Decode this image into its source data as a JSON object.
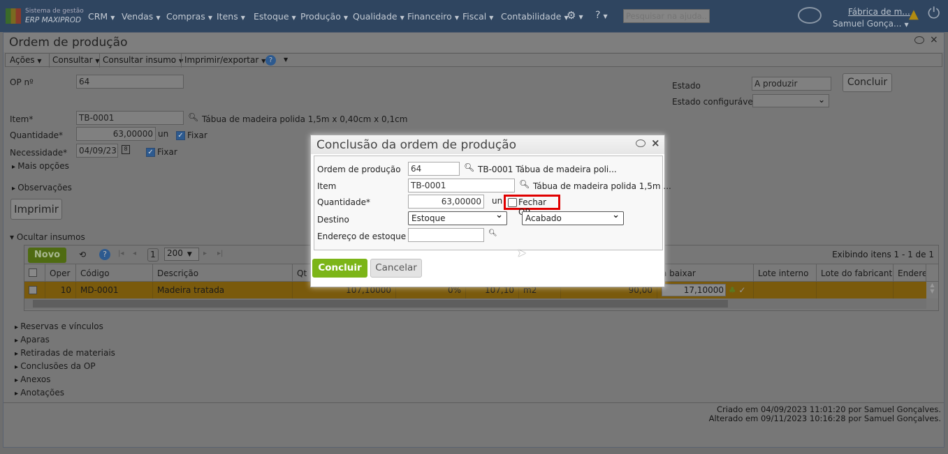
{
  "nav": {
    "logo_line1": "Sistema de gestão",
    "logo_line2": "ERP MAXIPROD",
    "menus": [
      "CRM",
      "Vendas",
      "Compras",
      "Itens",
      "Estoque",
      "Produção",
      "Qualidade",
      "Financeiro",
      "Fiscal",
      "Contabilidade"
    ],
    "search_placeholder": "Pesquisar na ajuda...",
    "company": "Fábrica de m...",
    "user": "Samuel Gonça..."
  },
  "window": {
    "title": "Ordem de produção",
    "toolbar": [
      "Ações",
      "Consultar",
      "Consultar insumo",
      "Imprimir/exportar"
    ]
  },
  "form": {
    "op_label": "OP nº",
    "op_value": "64",
    "item_label": "Item*",
    "item_value": "TB-0001",
    "item_desc": "Tábua de madeira polida 1,5m x 0,40cm x 0,1cm",
    "qty_label": "Quantidade*",
    "qty_value": "63,00000",
    "qty_unit": "un",
    "fixar": "Fixar",
    "need_label": "Necessidade*",
    "need_value": "04/09/23",
    "mais_opcoes": "Mais opções",
    "observacoes": "Observações",
    "imprimir": "Imprimir",
    "estado_label": "Estado",
    "estado_value": "A produzir",
    "estado_conf_label": "Estado configurável",
    "concluir": "Concluir"
  },
  "insumos": {
    "toggle": "Ocultar insumos",
    "novo": "Novo",
    "page": "1",
    "page_size": "200",
    "info": "Exibindo itens 1 - 1 de 1",
    "columns": [
      "Oper",
      "Código",
      "Descrição",
      "Qt",
      "a baixar",
      "Lote interno",
      "Lote do fabricante",
      "Endere"
    ],
    "row": {
      "oper": "10",
      "codigo": "MD-0001",
      "descricao": "Madeira tratada",
      "v1": "107,10000",
      "v2": "0%",
      "v3": "107,10",
      "v4": "m2",
      "v5": "90,00",
      "a_baixar": "17,10000"
    }
  },
  "sections": [
    "Reservas e vínculos",
    "Aparas",
    "Retiradas de materiais",
    "Conclusões da OP",
    "Anexos",
    "Anotações"
  ],
  "footer": {
    "created": "Criado em 04/09/2023 11:01:20 por Samuel Gonçalves.",
    "altered": "Alterado em 09/11/2023 10:16:28 por Samuel Gonçalves."
  },
  "dialog": {
    "title": "Conclusão da ordem de produção",
    "op_label": "Ordem de produção",
    "op_value": "64",
    "op_desc": "TB-0001 Tábua de madeira poli...",
    "item_label": "Item",
    "item_value": "TB-0001",
    "item_desc": "Tábua de madeira polida 1,5m ...",
    "qty_label": "Quantidade*",
    "qty_value": "63,00000",
    "qty_unit": "un",
    "fechar_op": "Fechar OP",
    "destino_label": "Destino",
    "destino_value": "Estoque",
    "destino2_value": "Acabado",
    "endereco_label": "Endereço de estoque",
    "concluir": "Concluir",
    "cancelar": "Cancelar"
  },
  "colors": {
    "accent_green": "#7cb518",
    "highlight_red": "#e00000",
    "row_selected": "#7a5a0c"
  }
}
